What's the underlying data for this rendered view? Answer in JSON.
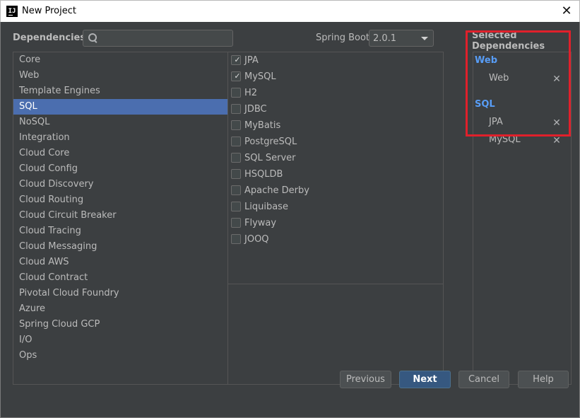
{
  "window": {
    "title": "New Project",
    "app_icon": "IJ"
  },
  "header": {
    "dependencies_label": "Dependencies",
    "search": {
      "value": "",
      "placeholder": ""
    },
    "spring_boot_label": "Spring Boot",
    "spring_boot_version": "2.0.1",
    "selected_label": "Selected Dependencies"
  },
  "categories": [
    "Core",
    "Web",
    "Template Engines",
    "SQL",
    "NoSQL",
    "Integration",
    "Cloud Core",
    "Cloud Config",
    "Cloud Discovery",
    "Cloud Routing",
    "Cloud Circuit Breaker",
    "Cloud Tracing",
    "Cloud Messaging",
    "Cloud AWS",
    "Cloud Contract",
    "Pivotal Cloud Foundry",
    "Azure",
    "Spring Cloud GCP",
    "I/O",
    "Ops"
  ],
  "active_category": "SQL",
  "dependencies": [
    {
      "label": "JPA",
      "checked": true
    },
    {
      "label": "MySQL",
      "checked": true
    },
    {
      "label": "H2",
      "checked": false
    },
    {
      "label": "JDBC",
      "checked": false
    },
    {
      "label": "MyBatis",
      "checked": false
    },
    {
      "label": "PostgreSQL",
      "checked": false
    },
    {
      "label": "SQL Server",
      "checked": false
    },
    {
      "label": "HSQLDB",
      "checked": false
    },
    {
      "label": "Apache Derby",
      "checked": false
    },
    {
      "label": "Liquibase",
      "checked": false
    },
    {
      "label": "Flyway",
      "checked": false
    },
    {
      "label": "JOOQ",
      "checked": false
    }
  ],
  "selected": [
    {
      "group": "Web",
      "items": [
        "Web"
      ]
    },
    {
      "group": "SQL",
      "items": [
        "JPA",
        "MySQL"
      ]
    }
  ],
  "buttons": {
    "previous": "Previous",
    "next": "Next",
    "cancel": "Cancel",
    "help": "Help"
  },
  "glyphs": {
    "close": "✕",
    "check": "✓",
    "remove": "✕"
  },
  "colors": {
    "accent": "#4b6eaf",
    "group_label": "#589df6",
    "highlight_box": "#e0202b",
    "primary_button": "#365880"
  }
}
